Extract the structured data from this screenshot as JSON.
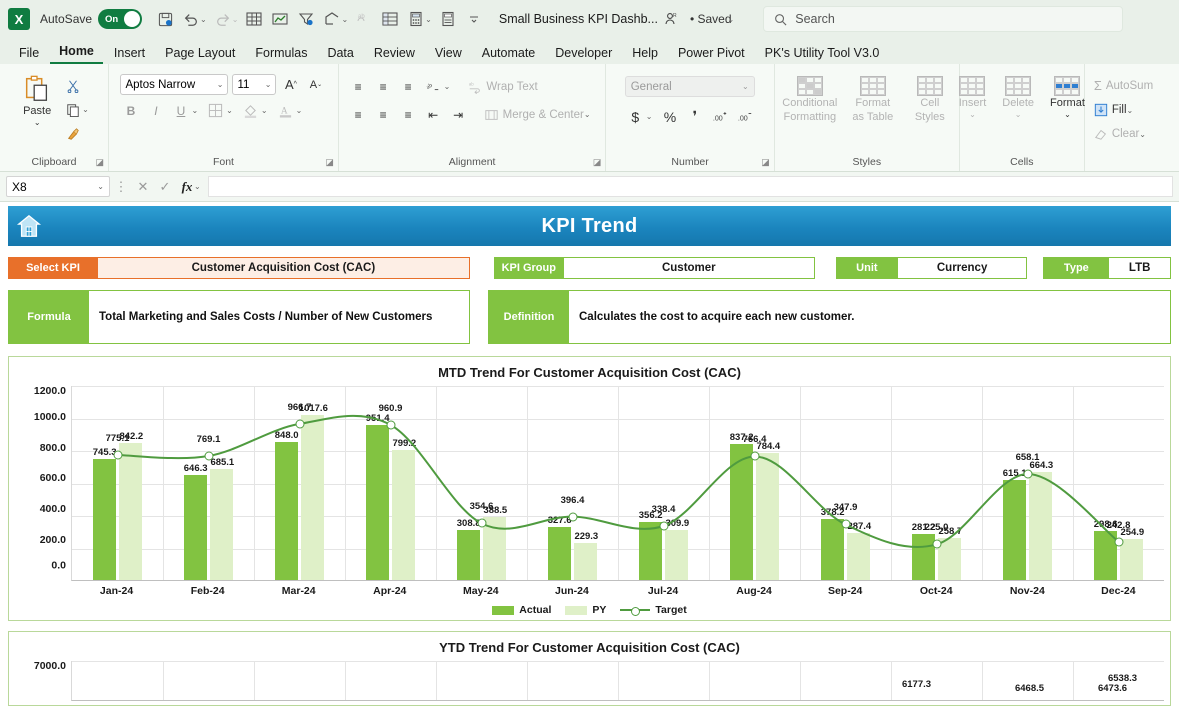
{
  "titlebar": {
    "logo_text": "X",
    "autosave_label": "AutoSave",
    "autosave_state": "On",
    "doc_title": "Small Business KPI Dashb...",
    "saved_status": "• Saved",
    "search_placeholder": "Search"
  },
  "ribbon_tabs": [
    {
      "label": "File",
      "active": false
    },
    {
      "label": "Home",
      "active": true
    },
    {
      "label": "Insert",
      "active": false
    },
    {
      "label": "Page Layout",
      "active": false
    },
    {
      "label": "Formulas",
      "active": false
    },
    {
      "label": "Data",
      "active": false
    },
    {
      "label": "Review",
      "active": false
    },
    {
      "label": "View",
      "active": false
    },
    {
      "label": "Automate",
      "active": false
    },
    {
      "label": "Developer",
      "active": false
    },
    {
      "label": "Help",
      "active": false
    },
    {
      "label": "Power Pivot",
      "active": false
    },
    {
      "label": "PK's Utility Tool V3.0",
      "active": false
    }
  ],
  "ribbon": {
    "clipboard": {
      "group_label": "Clipboard",
      "paste_label": "Paste"
    },
    "font": {
      "group_label": "Font",
      "font_name": "Aptos Narrow",
      "font_size": "11",
      "bold": "B",
      "italic": "I",
      "underline": "U"
    },
    "alignment": {
      "group_label": "Alignment",
      "wrap_text": "Wrap Text",
      "merge_center": "Merge & Center"
    },
    "number": {
      "group_label": "Number",
      "format": "General",
      "currency": "$",
      "percent": "%",
      "comma": "‰"
    },
    "styles": {
      "group_label": "Styles",
      "conditional_formatting": "Conditional Formatting",
      "format_as_table": "Format as Table",
      "cell_styles": "Cell Styles"
    },
    "cells": {
      "group_label": "Cells",
      "insert": "Insert",
      "delete": "Delete",
      "format": "Format"
    },
    "editing": {
      "autosum": "AutoSum",
      "fill": "Fill",
      "clear": "Clear"
    }
  },
  "formula_bar": {
    "name_box": "X8",
    "formula_value": ""
  },
  "dashboard": {
    "banner_title": "KPI Trend",
    "chips": [
      {
        "key": "Select KPI",
        "value": "Customer Acquisition Cost (CAC)",
        "color": "orange"
      },
      {
        "key": "KPI Group",
        "value": "Customer",
        "color": "green"
      },
      {
        "key": "Unit",
        "value": "Currency",
        "color": "green"
      },
      {
        "key": "Type",
        "value": "LTB",
        "color": "green"
      }
    ],
    "details": [
      {
        "key": "Formula",
        "value": "Total Marketing and Sales Costs / Number of New Customers"
      },
      {
        "key": "Definition",
        "value": "Calculates the cost to acquire each new customer."
      }
    ]
  },
  "chart_data": [
    {
      "type": "bar",
      "id": "mtd",
      "title": "MTD Trend For Customer Acquisition Cost (CAC)",
      "xlabel": "",
      "ylabel": "",
      "ylim": [
        0,
        1200
      ],
      "ytick_labels": [
        "1200.0",
        "1000.0",
        "800.0",
        "600.0",
        "400.0",
        "200.0",
        "0.0"
      ],
      "ytick_values": [
        1200,
        1000,
        800,
        600,
        400,
        200,
        0
      ],
      "grid": true,
      "legend_position": "bottom",
      "categories": [
        "Jan-24",
        "Feb-24",
        "Mar-24",
        "Apr-24",
        "May-24",
        "Jun-24",
        "Jul-24",
        "Aug-24",
        "Sep-24",
        "Oct-24",
        "Nov-24",
        "Dec-24"
      ],
      "series": [
        {
          "name": "Actual",
          "type": "bar",
          "color": "#82c341",
          "values": [
            745.3,
            646.3,
            848.0,
            951.4,
            308.8,
            327.6,
            356.2,
            837.2,
            378.2,
            281.2,
            615.1,
            298.6
          ]
        },
        {
          "name": "PY",
          "type": "bar",
          "color": "#dff0c8",
          "values": [
            842.2,
            685.1,
            1017.6,
            799.2,
            388.5,
            229.3,
            309.9,
            784.4,
            287.4,
            258.7,
            664.3,
            254.9
          ]
        },
        {
          "name": "Target",
          "type": "line",
          "color": "#4f9b3f",
          "values": [
            775.1,
            769.1,
            966.7,
            960.9,
            354.6,
            396.4,
            338.4,
            766.4,
            347.9,
            225.0,
            658.1,
            242.8
          ]
        }
      ]
    },
    {
      "type": "bar",
      "id": "ytd",
      "title": "YTD Trend For Customer Acquisition Cost (CAC)",
      "ylim": [
        0,
        7000
      ],
      "ytick_labels": [
        "7000.0"
      ],
      "grid": true,
      "visible_labels": [
        "6177.3",
        "6468.5",
        "6473.6",
        "6538.3"
      ],
      "categories": [],
      "series": []
    }
  ]
}
